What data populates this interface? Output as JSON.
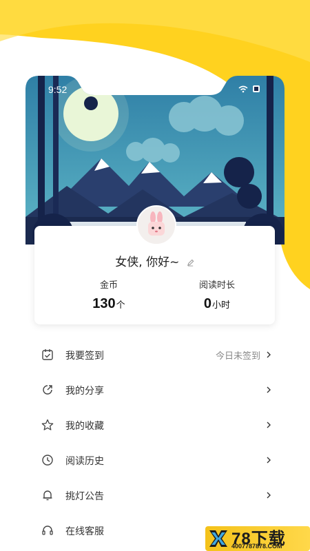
{
  "status_bar": {
    "time": "9:52"
  },
  "profile": {
    "greeting": "女侠, 你好~",
    "stats": [
      {
        "label": "金币",
        "value": "130",
        "unit": "个"
      },
      {
        "label": "阅读时长",
        "value": "0",
        "unit": "小时"
      }
    ]
  },
  "menu": {
    "items": [
      {
        "label": "我要签到",
        "icon": "calendar-check-icon",
        "right": "今日未签到"
      },
      {
        "label": "我的分享",
        "icon": "share-icon"
      },
      {
        "label": "我的收藏",
        "icon": "star-icon"
      },
      {
        "label": "阅读历史",
        "icon": "clock-icon"
      },
      {
        "label": "挑灯公告",
        "icon": "bell-icon"
      },
      {
        "label": "在线客服",
        "icon": "headset-icon"
      }
    ]
  },
  "watermark": {
    "big": "78下载",
    "small": "4007787878.COM"
  },
  "colors": {
    "accent": "#ffd21f",
    "sky": "#3f8fb0",
    "mountain": "#2a3f6e"
  }
}
